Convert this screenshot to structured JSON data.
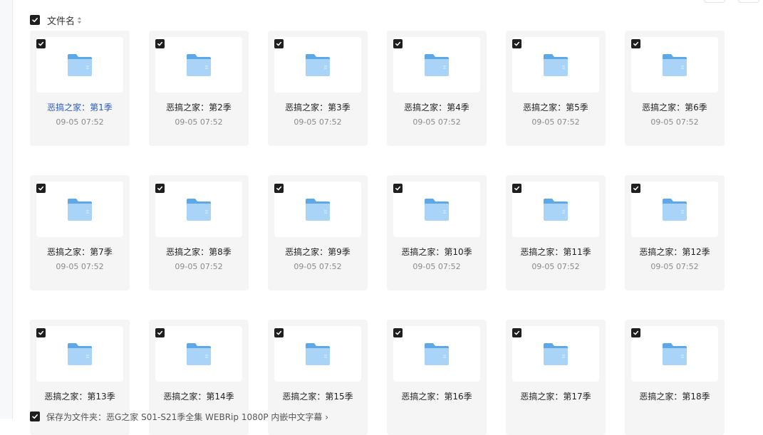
{
  "header": {
    "label": "文件名"
  },
  "folders": [
    {
      "name": "恶搞之家：第1季",
      "date": "09-05 07:52",
      "active": true
    },
    {
      "name": "恶搞之家：第2季",
      "date": "09-05 07:52"
    },
    {
      "name": "恶搞之家：第3季",
      "date": "09-05 07:52"
    },
    {
      "name": "恶搞之家：第4季",
      "date": "09-05 07:52"
    },
    {
      "name": "恶搞之家：第5季",
      "date": "09-05 07:52"
    },
    {
      "name": "恶搞之家：第6季",
      "date": "09-05 07:52"
    },
    {
      "name": "恶搞之家：第7季",
      "date": "09-05 07:52"
    },
    {
      "name": "恶搞之家：第8季",
      "date": "09-05 07:52"
    },
    {
      "name": "恶搞之家：第9季",
      "date": "09-05 07:52"
    },
    {
      "name": "恶搞之家：第10季",
      "date": "09-05 07:52"
    },
    {
      "name": "恶搞之家：第11季",
      "date": "09-05 07:52"
    },
    {
      "name": "恶搞之家：第12季",
      "date": "09-05 07:52"
    },
    {
      "name": "恶搞之家：第13季",
      "date": ""
    },
    {
      "name": "恶搞之家：第14季",
      "date": ""
    },
    {
      "name": "恶搞之家：第15季",
      "date": ""
    },
    {
      "name": "恶搞之家：第16季",
      "date": ""
    },
    {
      "name": "恶搞之家：第17季",
      "date": ""
    },
    {
      "name": "恶搞之家：第18季",
      "date": ""
    }
  ],
  "footer": {
    "text": "保存为文件夹：恶G之家 S01-S21季全集 WEBRip 1080P 内嵌中文字幕 ›"
  },
  "colors": {
    "card_bg": "#f5f5f6",
    "active_text": "#2a5cc4",
    "folder_light": "#a9d4f7",
    "folder_dark": "#5fa8e8"
  },
  "icons": {
    "folder": "folder-icon",
    "checkbox": "checkbox-checked-icon",
    "sort": "sort-icon"
  }
}
